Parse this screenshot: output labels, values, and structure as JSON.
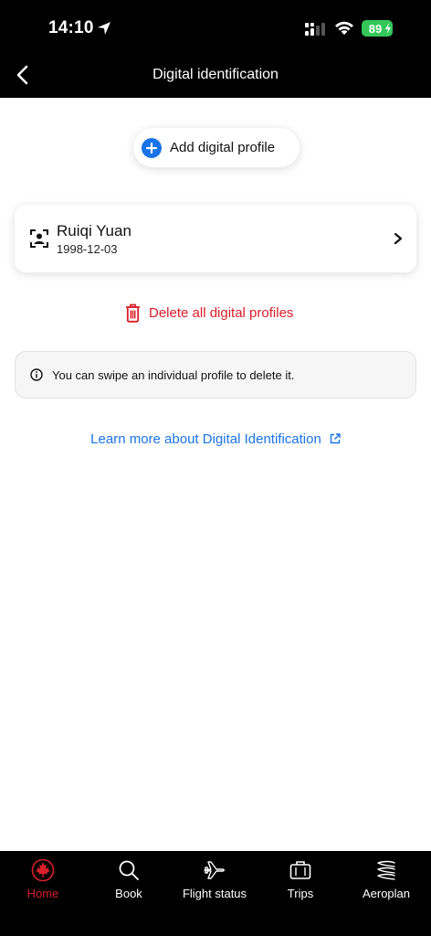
{
  "status_bar": {
    "time": "14:10",
    "battery": "89"
  },
  "header": {
    "title": "Digital identification"
  },
  "main": {
    "add_profile_label": "Add digital profile",
    "profiles": [
      {
        "name": "Ruiqi Yuan",
        "dob": "1998-12-03"
      }
    ],
    "delete_all_label": "Delete all digital profiles",
    "info_text": "You can swipe an individual profile to delete it.",
    "learn_more_label": "Learn more about Digital Identification"
  },
  "tabbar": {
    "items": [
      {
        "label": "Home",
        "icon": "maple-leaf-icon",
        "active": true
      },
      {
        "label": "Book",
        "icon": "search-icon",
        "active": false
      },
      {
        "label": "Flight status",
        "icon": "airplane-icon",
        "active": false
      },
      {
        "label": "Trips",
        "icon": "suitcase-icon",
        "active": false
      },
      {
        "label": "Aeroplan",
        "icon": "aeroplan-icon",
        "active": false
      }
    ]
  },
  "colors": {
    "accent": "#1a73e8",
    "danger": "#d8202a",
    "battery": "#34c759",
    "header_bg": "#000000"
  }
}
